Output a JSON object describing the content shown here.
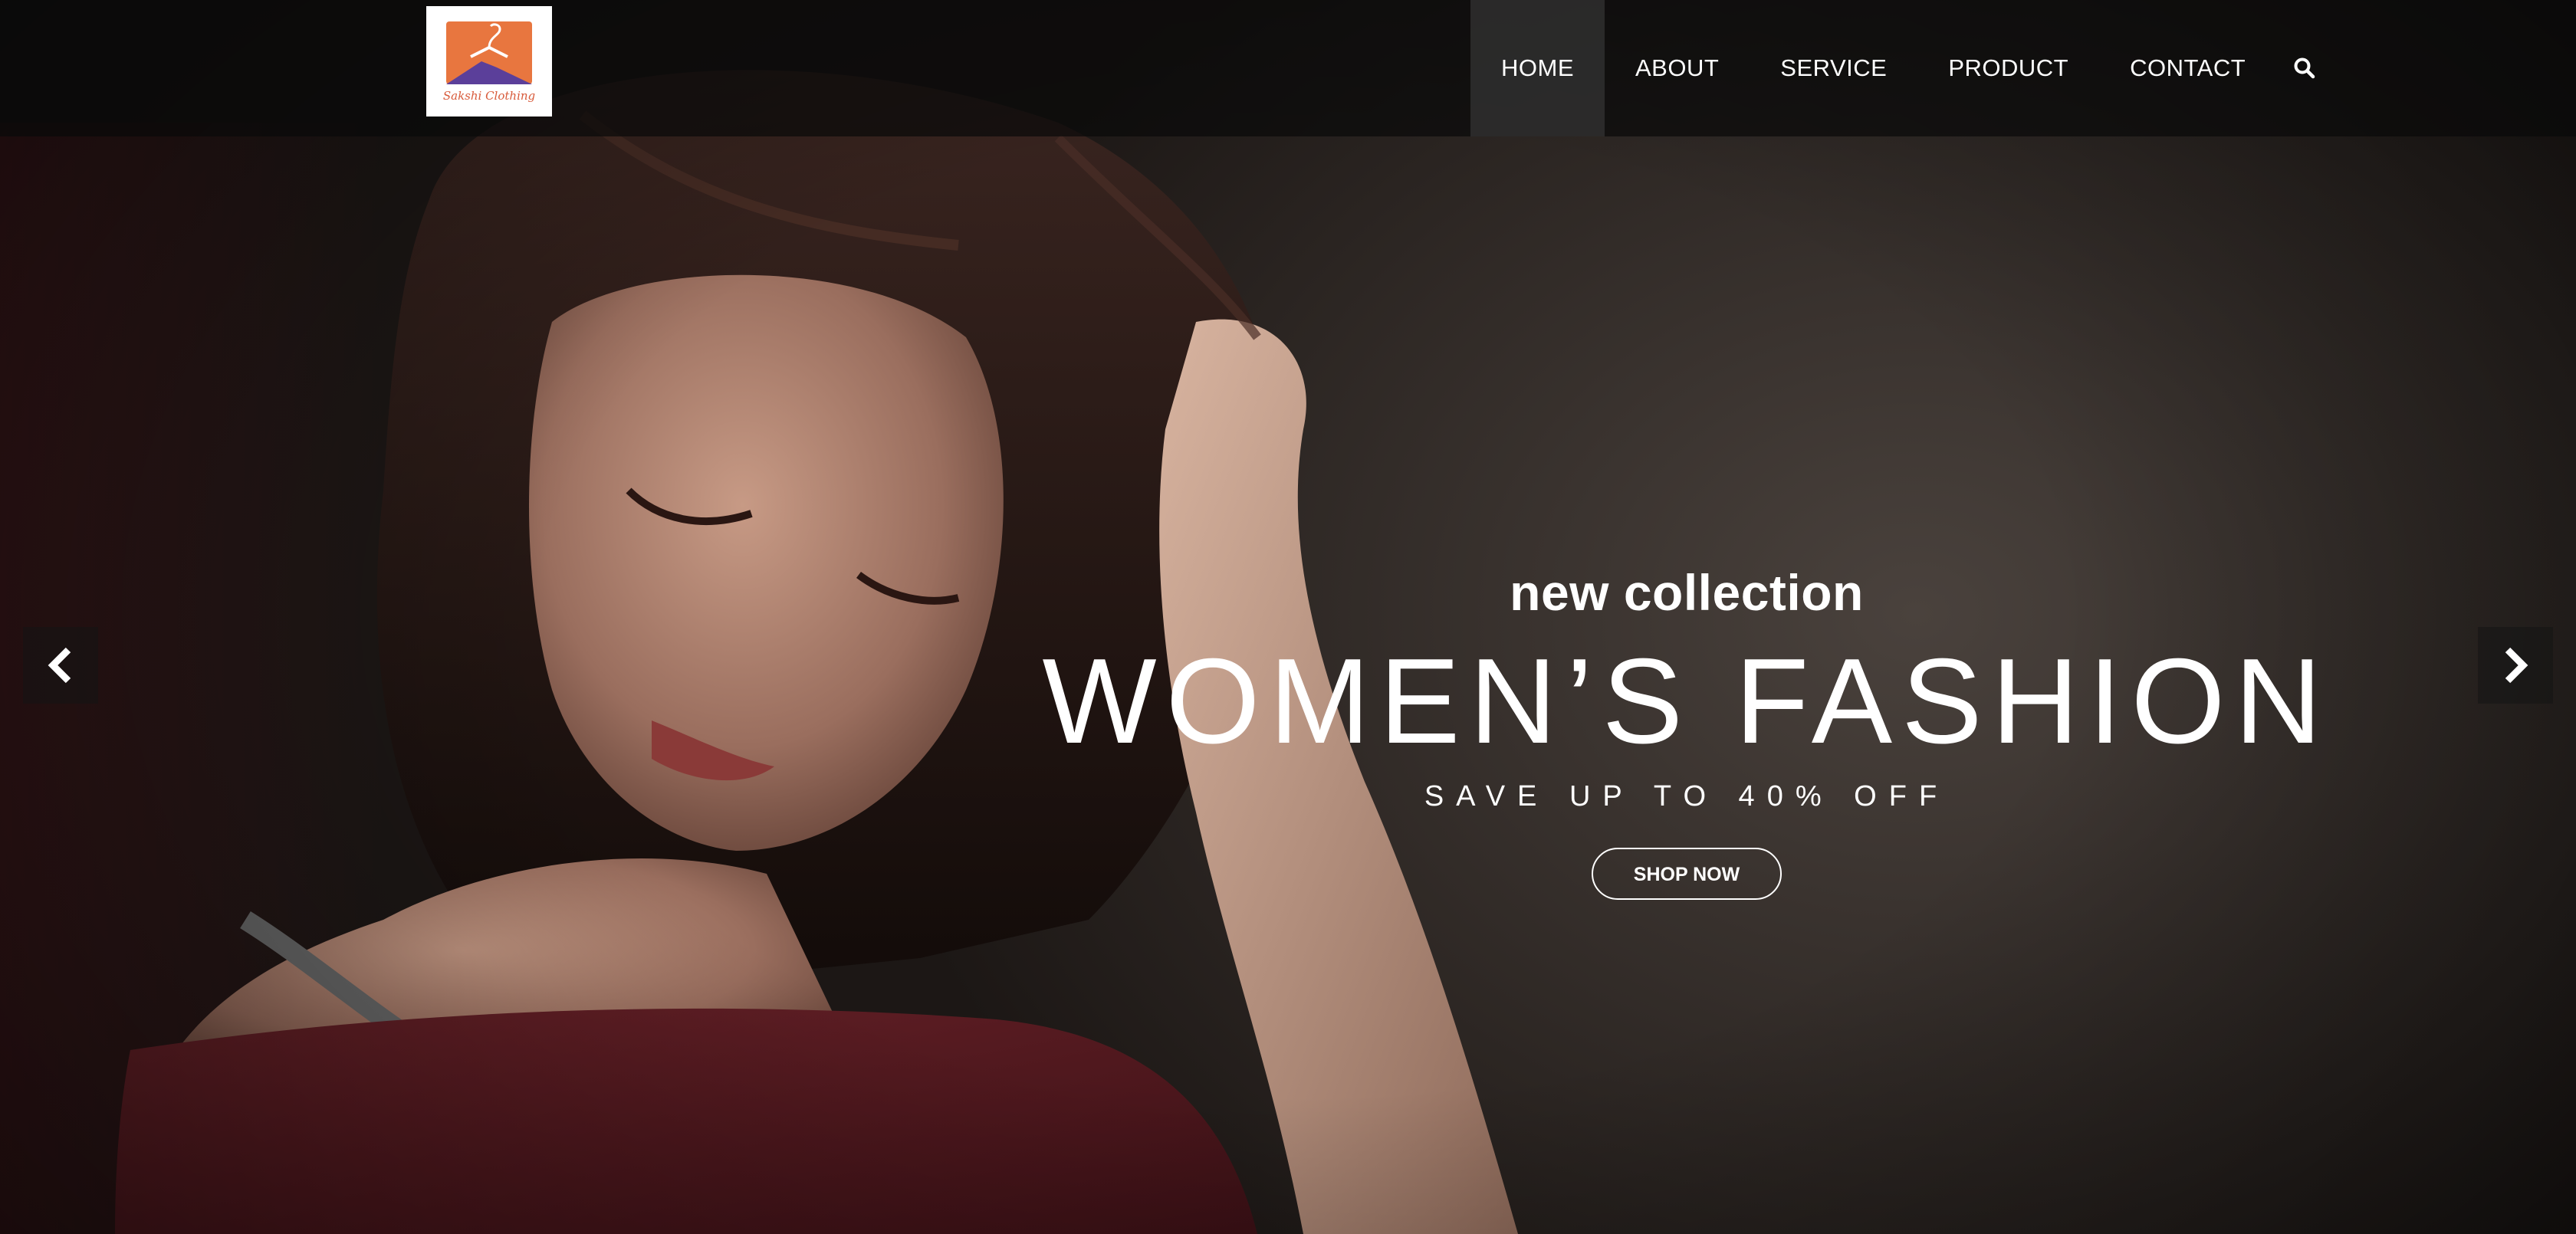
{
  "brand": {
    "logo_text": "Sakshi Clothing",
    "logo_colors": {
      "orange": "#e8763f",
      "purple": "#5b3f9a",
      "text": "#d85a3a"
    }
  },
  "nav": {
    "items": [
      {
        "label": "HOME",
        "active": true
      },
      {
        "label": "ABOUT",
        "active": false
      },
      {
        "label": "SERVICE",
        "active": false
      },
      {
        "label": "PRODUCT",
        "active": false
      },
      {
        "label": "CONTACT",
        "active": false
      }
    ],
    "search_icon": "search-icon"
  },
  "slider": {
    "prev_icon": "chevron-left-icon",
    "next_icon": "chevron-right-icon",
    "kicker": "new collection",
    "title": "WOMEN’S FASHION",
    "subtitle": "SAVE UP TO 40% OFF",
    "cta_label": "SHOP NOW"
  },
  "colors": {
    "nav_bg": "#0a0a0a",
    "text": "#ffffff",
    "sweater": "#5a1a22"
  }
}
